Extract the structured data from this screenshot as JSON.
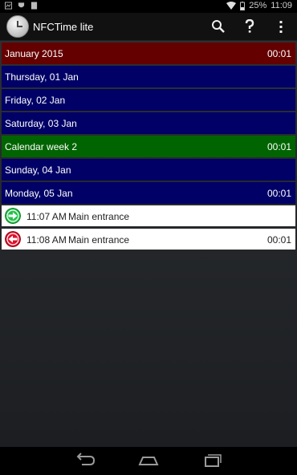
{
  "status_bar": {
    "battery": "25%",
    "time": "11:09"
  },
  "app": {
    "title": "NFCTime lite"
  },
  "rows": {
    "month": {
      "label": "January 2015",
      "duration": "00:01"
    },
    "thursday": {
      "label": "Thursday, 01 Jan"
    },
    "friday": {
      "label": "Friday, 02 Jan"
    },
    "saturday": {
      "label": "Saturday, 03 Jan"
    },
    "week": {
      "label": "Calendar week 2",
      "duration": "00:01"
    },
    "sunday": {
      "label": "Sunday, 04 Jan"
    },
    "monday": {
      "label": "Monday, 05 Jan",
      "duration": "00:01"
    },
    "checkin": {
      "time": "11:07 AM",
      "place": "Main entrance",
      "icon": "checkin-arrow-icon",
      "color": "#22c34a"
    },
    "checkout": {
      "time": "11:08 AM",
      "place": "Main entrance",
      "duration": "00:01",
      "icon": "checkout-arrow-icon",
      "color": "#e0102a"
    }
  },
  "colors": {
    "month": "#640000",
    "day": "#000066",
    "week": "#006400"
  }
}
